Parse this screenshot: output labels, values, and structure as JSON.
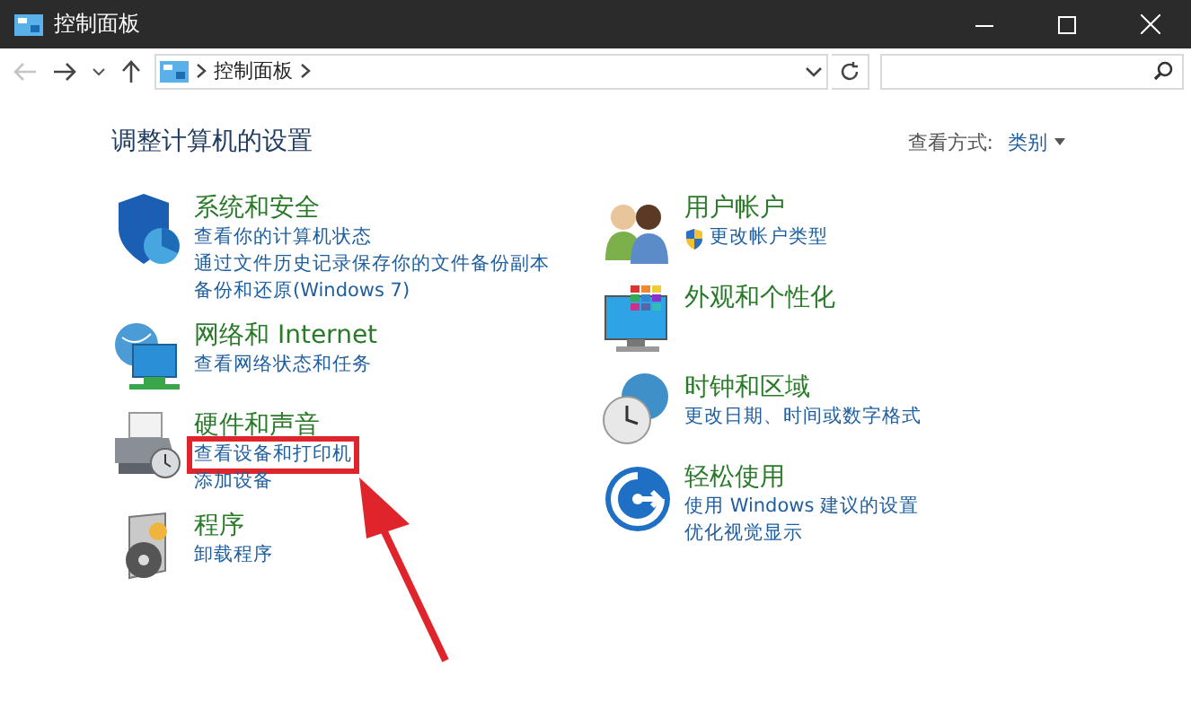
{
  "window": {
    "title": "控制面板"
  },
  "address_bar": {
    "path": [
      "控制面板"
    ],
    "back_disabled": true
  },
  "heading": "调整计算机的设置",
  "view_by": {
    "label": "查看方式:",
    "value": "类别"
  },
  "left_categories": [
    {
      "title": "系统和安全",
      "links": [
        {
          "text": "查看你的计算机状态"
        },
        {
          "text": "通过文件历史记录保存你的文件备份副本"
        },
        {
          "text": "备份和还原(Windows 7)"
        }
      ]
    },
    {
      "title": "网络和 Internet",
      "links": [
        {
          "text": "查看网络状态和任务"
        }
      ]
    },
    {
      "title": "硬件和声音",
      "links": [
        {
          "text": "查看设备和打印机",
          "highlighted": true
        },
        {
          "text": "添加设备"
        }
      ]
    },
    {
      "title": "程序",
      "links": [
        {
          "text": "卸载程序"
        }
      ]
    }
  ],
  "right_categories": [
    {
      "title": "用户帐户",
      "links": [
        {
          "text": "更改帐户类型",
          "kind": "shield"
        }
      ]
    },
    {
      "title": "外观和个性化"
    },
    {
      "title": "时钟和区域",
      "links": [
        {
          "text": "更改日期、时间或数字格式"
        }
      ]
    },
    {
      "title": "轻松使用",
      "links": [
        {
          "text": "使用 Windows 建议的设置"
        },
        {
          "text": "优化视觉显示"
        }
      ]
    }
  ]
}
